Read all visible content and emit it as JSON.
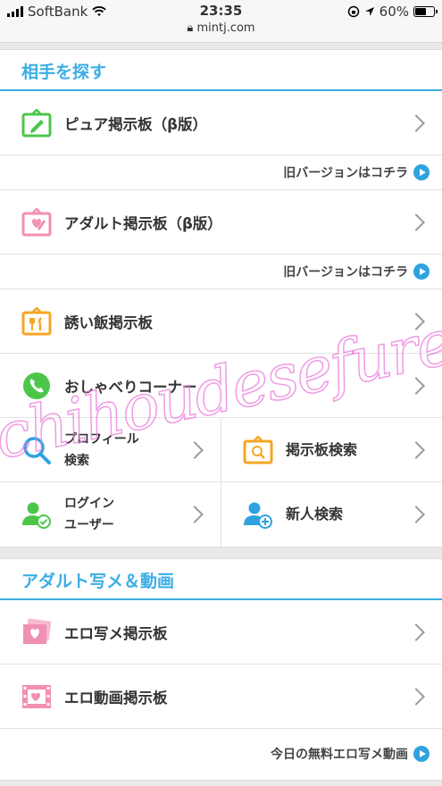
{
  "status": {
    "carrier": "SoftBank",
    "time": "23:35",
    "url": "mintj.com",
    "battery": "60%",
    "battery_level": 0.6
  },
  "section1": {
    "title": "相手を探す",
    "pure": {
      "label": "ピュア掲示板（β版）",
      "sub": "旧バージョンはコチラ"
    },
    "adult": {
      "label": "アダルト掲示板（β版）",
      "sub": "旧バージョンはコチラ"
    },
    "meal": {
      "label": "誘い飯掲示板"
    },
    "chat": {
      "label": "おしゃべりコーナー"
    },
    "grid": {
      "profile": {
        "line1": "プロフィール",
        "line2": "検索"
      },
      "board_search": {
        "label": "掲示板検索"
      },
      "login": {
        "line1": "ログイン",
        "line2": "ユーザー"
      },
      "new_search": {
        "label": "新人検索"
      }
    }
  },
  "section2": {
    "title": "アダルト写メ＆動画",
    "photo": {
      "label": "エロ写メ掲示板"
    },
    "video": {
      "label": "エロ動画掲示板"
    },
    "today": "今日の無料エロ写メ動画"
  },
  "watermark": "chihoudesefuregetnet",
  "colors": {
    "accent": "#3aaee5",
    "green": "#4cc64a",
    "pink": "#f28fb4",
    "orange": "#f5a623",
    "blue": "#2ea3e0"
  }
}
